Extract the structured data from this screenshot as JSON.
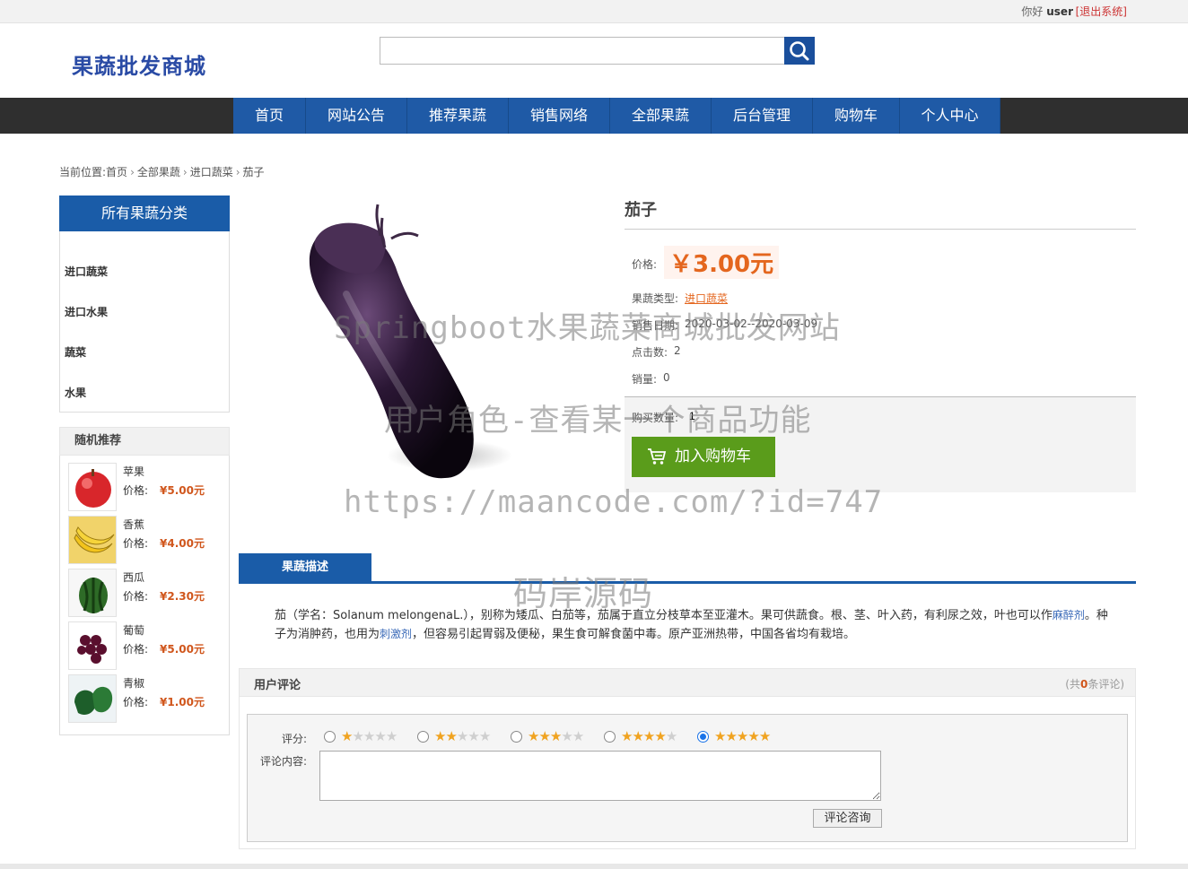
{
  "topbar": {
    "greeting": "你好",
    "username": "user",
    "logout": "[退出系统]"
  },
  "header": {
    "logo": "果蔬批发商城",
    "search_value": ""
  },
  "nav": [
    "首页",
    "网站公告",
    "推荐果蔬",
    "销售网络",
    "全部果蔬",
    "后台管理",
    "购物车",
    "个人中心"
  ],
  "breadcrumb": {
    "prefix": "当前位置:",
    "items": [
      "首页",
      "全部果蔬",
      "进口蔬菜",
      "茄子"
    ]
  },
  "sidebar": {
    "category_title": "所有果蔬分类",
    "categories": [
      "进口蔬菜",
      "进口水果",
      "蔬菜",
      "水果"
    ],
    "recommend_title": "随机推荐",
    "price_label": "价格:",
    "recommend": [
      {
        "name": "苹果",
        "price": "¥5.00元"
      },
      {
        "name": "香蕉",
        "price": "¥4.00元"
      },
      {
        "name": "西瓜",
        "price": "¥2.30元"
      },
      {
        "name": "葡萄",
        "price": "¥5.00元"
      },
      {
        "name": "青椒",
        "price": "¥1.00元"
      }
    ]
  },
  "product": {
    "title": "茄子",
    "price_label": "价格:",
    "price": "￥3.00元",
    "type_label": "果蔬类型:",
    "type": "进口蔬菜",
    "date_label": "销售日期:",
    "date": "2020-03-02--2020-03-09",
    "clicks_label": "点击数:",
    "clicks": "2",
    "sales_label": "销量:",
    "sales": "0",
    "qty_label": "购买数量:",
    "qty": "1",
    "add_cart": "加入购物车"
  },
  "watermark": {
    "line1": "Springboot水果蔬菜商城批发网站",
    "line2": "用户角色-查看某一个商品功能",
    "line3": "https://maancode.com/?id=747",
    "line4": "码岸源码"
  },
  "description": {
    "tab": "果蔬描述",
    "part1": "茄（学名：Solanum melongenaL.），别称为矮瓜、白茄等，茄属于直立分枝草本至亚灌木。果可供蔬食。根、茎、叶入药，有利尿之效，叶也可以作",
    "kw1": "麻醉剂",
    "part2": "。种子为消肿药，也用为",
    "kw2": "刺激剂",
    "part3": "，但容易引起胃弱及便秘，果生食可解食菌中毒。原产亚洲热带，中国各省均有栽培。"
  },
  "comments": {
    "title": "用户评论",
    "count_prefix": "(共",
    "count": "0",
    "count_suffix": "条评论)",
    "score_label": "评分:",
    "content_label": "评论内容:",
    "submit": "评论咨询",
    "selected_score": 5,
    "content_value": ""
  },
  "colors": {
    "brand_blue": "#1a5ca8",
    "price_orange": "#e4661e",
    "cart_green": "#5a9c1b",
    "nav_dark": "#2f2f2f"
  }
}
